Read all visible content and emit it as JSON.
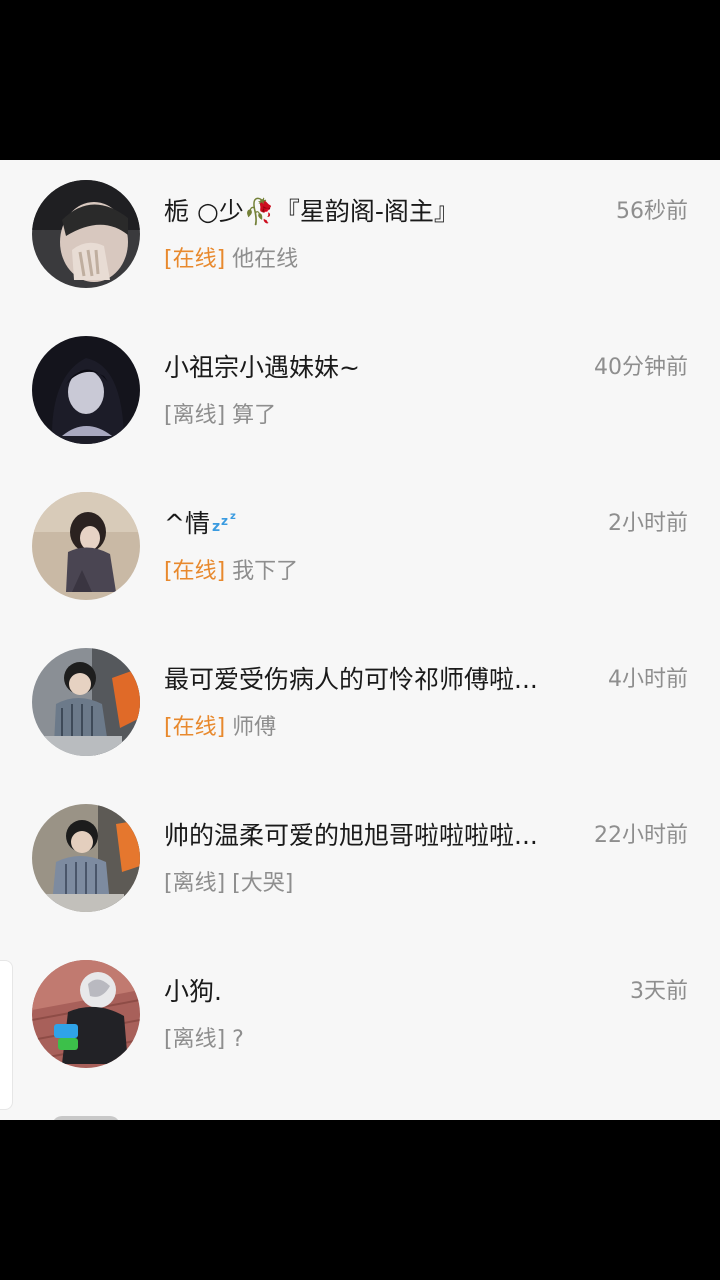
{
  "contacts": [
    {
      "name": "栀 ○少🥀『星韵阁-阁主』",
      "status": "[在线]",
      "online": true,
      "message": "他在线",
      "time": "56秒前"
    },
    {
      "name": "小祖宗小遇妹妹~",
      "status": "[离线]",
      "online": false,
      "message": "算了",
      "time": "40分钟前"
    },
    {
      "name": "^情",
      "status": "[在线]",
      "online": true,
      "message": "我下了",
      "time": "2小时前"
    },
    {
      "name": "最可爱受伤病人的可怜祁师傅啦...",
      "status": "[在线]",
      "online": true,
      "message": "师傅",
      "time": "4小时前"
    },
    {
      "name": "帅的温柔可爱的旭旭哥啦啦啦啦...",
      "status": "[离线]",
      "online": false,
      "message": "[大哭]",
      "time": "22小时前"
    },
    {
      "name": "小狗.",
      "status": "[离线]",
      "online": false,
      "message": "?",
      "time": "3天前"
    }
  ],
  "colors": {
    "online": "#e8892d",
    "offline": "#8e8e8e",
    "name": "#1a1a1a",
    "background": "#f7f7f7"
  },
  "icons": {
    "sleep": "zzz-icon"
  }
}
